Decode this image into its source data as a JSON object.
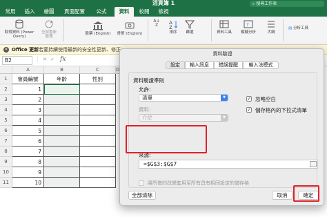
{
  "window": {
    "title": "活頁簿 1",
    "search_placeholder": "搜尋工作表"
  },
  "ribbon_tabs": [
    "常用",
    "插入",
    "繪圖",
    "頁面配置",
    "公式",
    "資料",
    "校閱",
    "檢視"
  ],
  "active_tab": "資料",
  "ribbon": {
    "get_data": "取得資料 (Power Query)",
    "refresh_all": "全部重新整理",
    "stocks": "股票 (English)",
    "currencies": "貨幣 (English)",
    "sort": "排序",
    "filter": "篩選",
    "data_tools": "資料工具",
    "what_if": "模擬分析",
    "outline": "大綱",
    "analysis": "分析工具"
  },
  "message_bar": {
    "label": "Office 更新",
    "text": "若要持續使用最新的安全性更新、修正"
  },
  "formula_bar": {
    "name_box": "B2",
    "fx": "fx",
    "formula": ""
  },
  "sheet": {
    "columns": [
      "A",
      "B",
      "C",
      "D"
    ],
    "rows": [
      "1",
      "2",
      "3",
      "4",
      "5",
      "6",
      "7",
      "8",
      "9",
      "10",
      "11"
    ],
    "headers": [
      "會員編號",
      "年齡",
      "性別"
    ],
    "ids": [
      "1",
      "2",
      "3",
      "4",
      "5",
      "6",
      "7",
      "8",
      "9",
      "10"
    ]
  },
  "dialog": {
    "title": "資料驗證",
    "tabs": [
      "設定",
      "輸入訊息",
      "錯誤提醒",
      "輸入法模式"
    ],
    "active_tab": "設定",
    "criteria_title": "資料驗證準則",
    "allow_label": "允許:",
    "allow_value": "清單",
    "data_label": "資料:",
    "data_value": "介於",
    "ignore_blank": "忽略空白",
    "in_cell_dropdown": "儲存格內的下拉式清單",
    "source_label": "來源:",
    "source_value": "=$G$3:$G$7",
    "apply_all": "將所做的改變套用至所有具有相同設定的儲存格",
    "clear_all": "全部清除",
    "cancel": "取消",
    "ok": "確定"
  },
  "colors": {
    "excel_green": "#1e7145",
    "highlight_red": "#e0202a",
    "accent_blue": "#3b82f6"
  }
}
